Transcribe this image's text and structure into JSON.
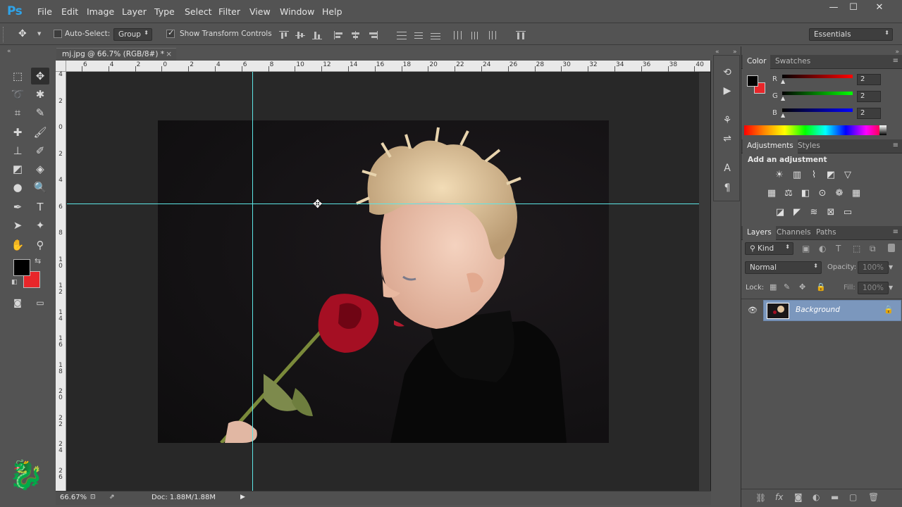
{
  "app": {
    "logo": "Ps"
  },
  "menu": [
    "File",
    "Edit",
    "Image",
    "Layer",
    "Type",
    "Select",
    "Filter",
    "View",
    "Window",
    "Help"
  ],
  "window_controls": {
    "minimize": "—",
    "maximize": "☐",
    "close": "✕"
  },
  "options": {
    "auto_select_label": "Auto-Select:",
    "auto_select_checked": false,
    "auto_select_target": "Group",
    "show_transform_label": "Show Transform Controls",
    "show_transform_checked": true,
    "workspace": "Essentials"
  },
  "document": {
    "tab_title": "mj.jpg @ 66.7% (RGB/8#) *",
    "ruler_top_labels": [
      "6",
      "4",
      "2",
      "0",
      "2",
      "4",
      "6",
      "8",
      "10",
      "12",
      "14",
      "16",
      "18",
      "20",
      "22",
      "24",
      "26",
      "28",
      "30",
      "32",
      "34",
      "36",
      "38",
      "40"
    ],
    "ruler_left_labels": [
      "4",
      "2",
      "0",
      "2",
      "4",
      "6",
      "8",
      "1\n0",
      "1\n2",
      "1\n4",
      "1\n6",
      "1\n8",
      "2\n0",
      "2\n2",
      "2\n4",
      "2\n6"
    ]
  },
  "status": {
    "zoom": "66.67%",
    "doc": "Doc: 1.88M/1.88M"
  },
  "color_panel": {
    "tabs": [
      "Color",
      "Swatches"
    ],
    "r_label": "R",
    "g_label": "G",
    "b_label": "B",
    "r_value": "2",
    "g_value": "2",
    "b_value": "2",
    "foreground": "#020202",
    "background": "#e8262a"
  },
  "adjustments_panel": {
    "tabs": [
      "Adjustments",
      "Styles"
    ],
    "heading": "Add an adjustment"
  },
  "layers_panel": {
    "tabs": [
      "Layers",
      "Channels",
      "Paths"
    ],
    "filter_kind": "Kind",
    "blend_mode": "Normal",
    "opacity_label": "Opacity:",
    "opacity_value": "100%",
    "lock_label": "Lock:",
    "fill_label": "Fill:",
    "fill_value": "100%",
    "layers": [
      {
        "name": "Background",
        "visible": true,
        "locked": true
      }
    ]
  },
  "toolbar_colors": {
    "foreground": "#000000",
    "background": "#e8262a"
  }
}
